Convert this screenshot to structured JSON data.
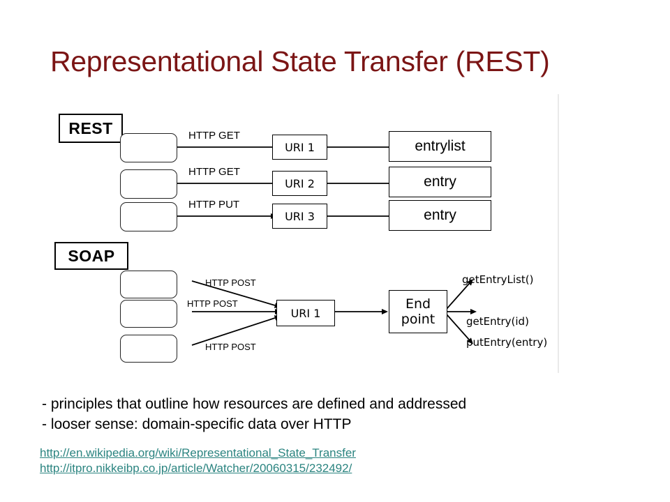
{
  "slide": {
    "title": "Representational State Transfer (REST)"
  },
  "diagram": {
    "rest": {
      "tag": "REST",
      "rows": [
        {
          "verb": "HTTP GET",
          "uri": "URI 1",
          "resource": "entrylist",
          "direction": "left"
        },
        {
          "verb": "HTTP GET",
          "uri": "URI 2",
          "resource": "entry",
          "direction": "left"
        },
        {
          "verb": "HTTP PUT",
          "uri": "URI 3",
          "resource": "entry",
          "direction": "right"
        }
      ]
    },
    "soap": {
      "tag": "SOAP",
      "verbs": [
        "HTTP POST",
        "HTTP POST",
        "HTTP POST"
      ],
      "uri": "URI 1",
      "endpoint_line1": "End",
      "endpoint_line2": "point",
      "operations": [
        "getEntryList()",
        "getEntry(id)",
        "putEntry(entry)"
      ]
    }
  },
  "bullets": [
    "- principles that outline how resources are defined and addressed",
    "- looser sense: domain-specific data over HTTP"
  ],
  "links": [
    "http://en.wikipedia.org/wiki/Representational_State_Transfer",
    "http://itpro.nikkeibp.co.jp/article/Watcher/20060315/232492/"
  ],
  "colors": {
    "title": "#7b1515",
    "link": "#2b8480",
    "stroke": "#000000",
    "background": "#ffffff"
  }
}
